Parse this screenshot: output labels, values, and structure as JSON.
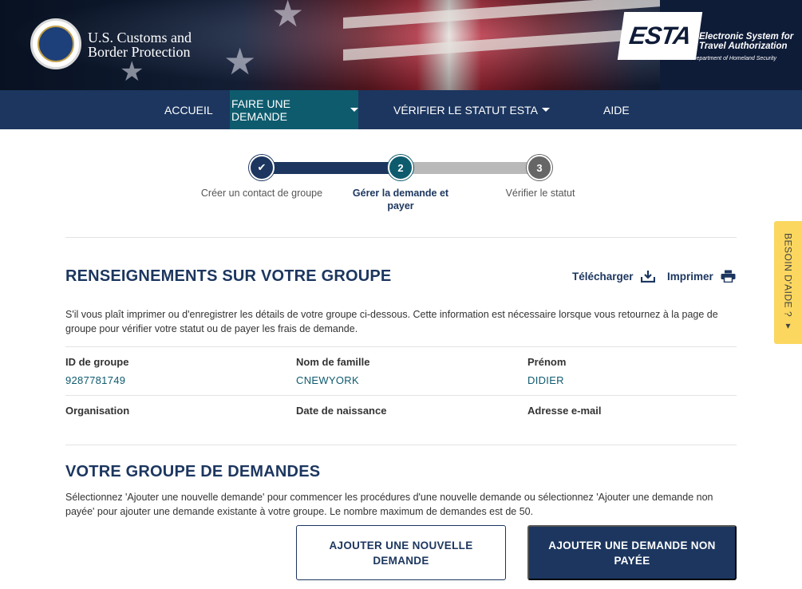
{
  "header": {
    "agency_line1": "U.S. Customs and",
    "agency_line2": "Border Protection",
    "esta_logo": "ESTA",
    "esta_line1": "Electronic System for",
    "esta_line2": "Travel Authorization",
    "esta_dept": "U.S. Department of Homeland Security"
  },
  "nav": {
    "items": [
      {
        "label": "ACCUEIL"
      },
      {
        "label": "FAIRE UNE DEMANDE"
      },
      {
        "label": "VÉRIFIER LE STATUT ESTA"
      },
      {
        "label": "AIDE"
      }
    ]
  },
  "stepper": {
    "steps": [
      {
        "number": "✔",
        "label": "Créer un contact de groupe"
      },
      {
        "number": "2",
        "label": "Gérer la demande et payer"
      },
      {
        "number": "3",
        "label": "Vérifier le statut"
      }
    ]
  },
  "group_info": {
    "title": "RENSEIGNEMENTS SUR VOTRE GROUPE",
    "download_label": "Télécharger",
    "print_label": "Imprimer",
    "description": "S'il vous plaît imprimer ou d'enregistrer les détails de votre groupe ci-dessous. Cette information est nécessaire lorsque vous retournez à la page de groupe pour vérifier votre statut ou de payer les frais de demande.",
    "fields": {
      "group_id_label": "ID de groupe",
      "group_id_value": "9287781749",
      "last_name_label": "Nom de famille",
      "last_name_value": "CNEWYORK",
      "first_name_label": "Prénom",
      "first_name_value": "DIDIER",
      "organization_label": "Organisation",
      "birth_date_label": "Date de naissance",
      "email_label": "Adresse e-mail"
    }
  },
  "applications": {
    "title": "VOTRE GROUPE DE DEMANDES",
    "description": "Sélectionnez 'Ajouter une nouvelle demande' pour commencer les procédures d'une nouvelle demande ou sélectionnez 'Ajouter une demande non payée' pour ajouter une demande existante à votre groupe. Le nombre maximum de demandes est de 50.",
    "add_new_label": "AJOUTER UNE NOUVELLE DEMANDE",
    "add_unpaid_label": "AJOUTER UNE DEMANDE NON PAYÉE"
  },
  "help_tab": {
    "label": "BESOIN D'AIDE ? ▾"
  },
  "colors": {
    "navy": "#1c365f",
    "teal": "#0e5b6e",
    "track_grey": "#b9b9b9",
    "help_yellow": "#fbd760"
  }
}
